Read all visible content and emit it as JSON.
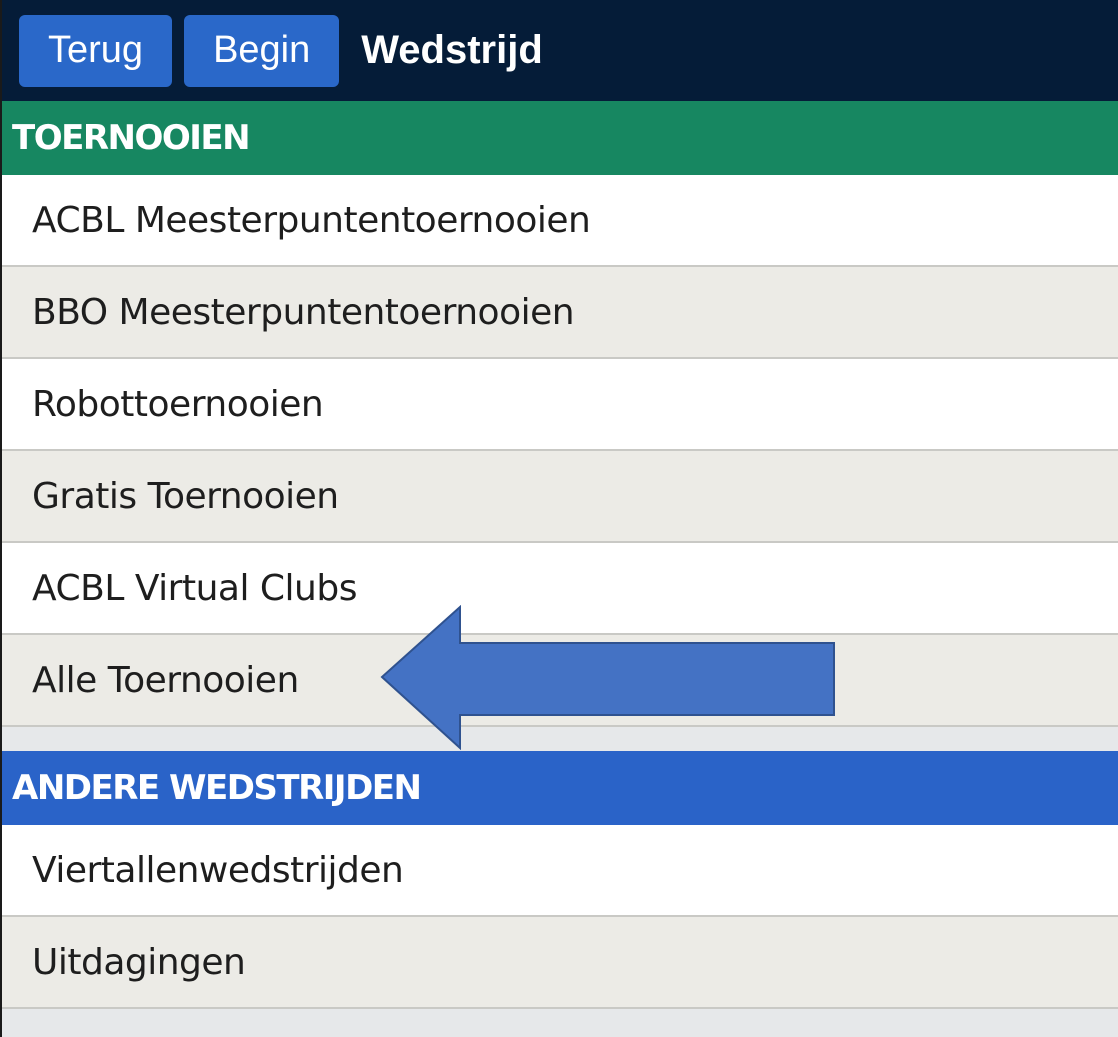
{
  "toolbar": {
    "back_label": "Terug",
    "home_label": "Begin",
    "title": "Wedstrijd"
  },
  "sections": [
    {
      "header": "TOERNOOIEN",
      "color": "#178761",
      "items": [
        "ACBL Meesterpuntentoernooien",
        "BBO Meesterpuntentoernooien",
        "Robottoernooien",
        "Gratis Toernooien",
        "ACBL Virtual Clubs",
        "Alle Toernooien"
      ]
    },
    {
      "header": "ANDERE WEDSTRIJDEN",
      "color": "#2a63c8",
      "items": [
        "Viertallenwedstrijden",
        "Uitdagingen"
      ]
    }
  ],
  "annotation": {
    "icon": "left-arrow-icon",
    "color": "#4472c4",
    "points_to": "Alle Toernooien"
  }
}
